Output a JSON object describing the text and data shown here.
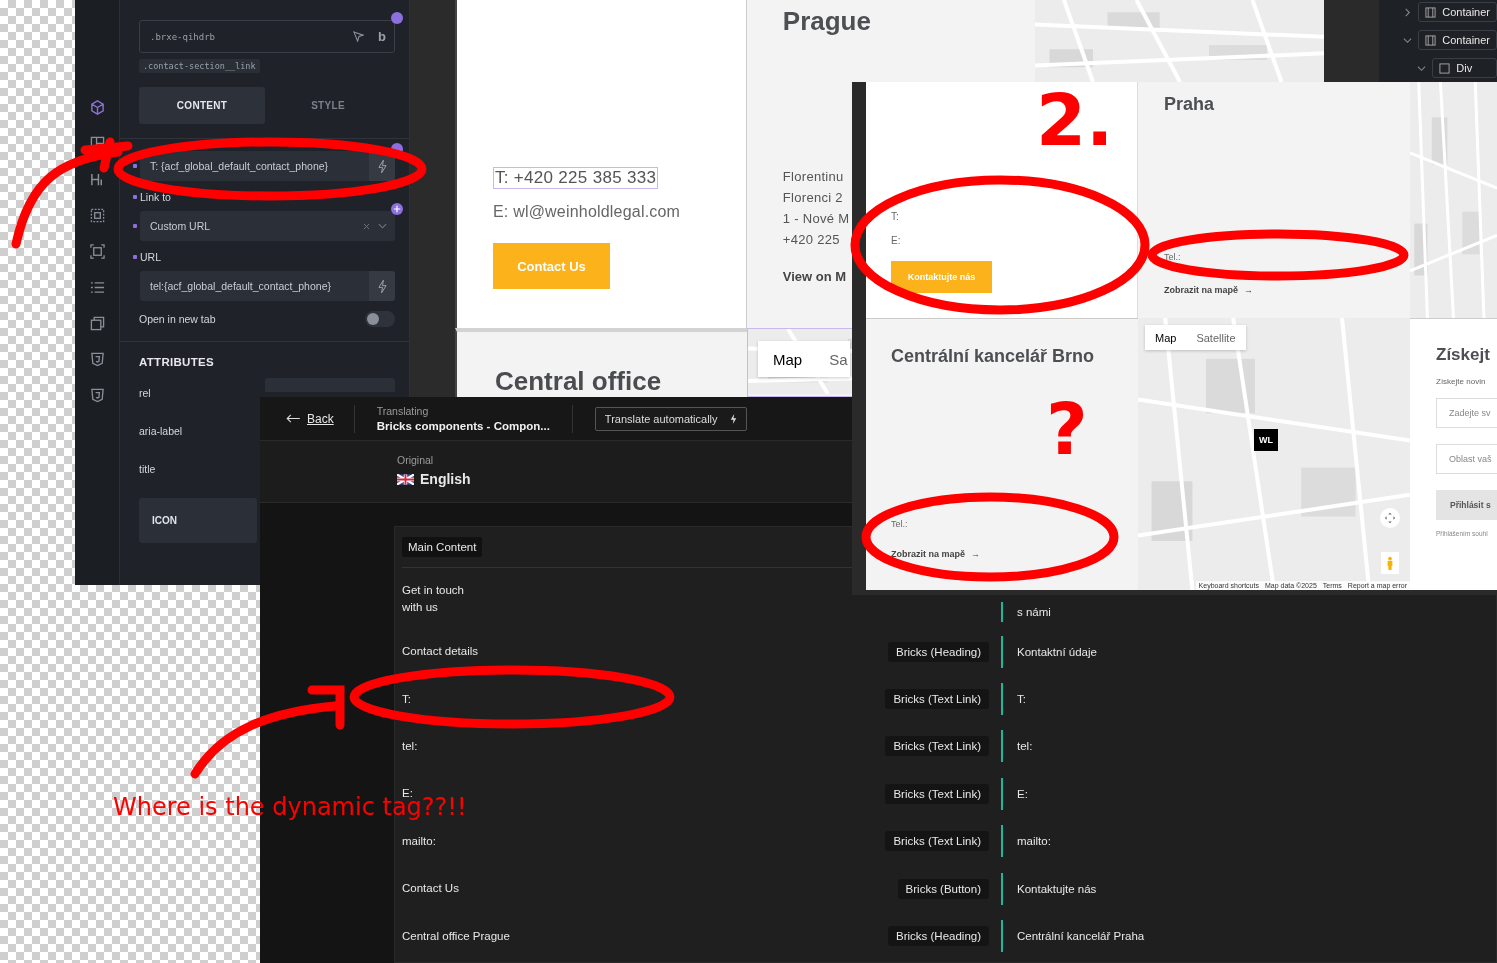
{
  "editor_panel": {
    "class_field": {
      "value": ".brxe-qihdrb",
      "badge": "b"
    },
    "class_tag": ".contact-section__link",
    "tabs": [
      {
        "label": "CONTENT",
        "selected": true
      },
      {
        "label": "STYLE",
        "selected": false
      }
    ],
    "text_field": {
      "value": "T: {acf_global_default_contact_phone}"
    },
    "link_to": {
      "label": "Link to",
      "value": "Custom URL"
    },
    "url": {
      "label": "URL",
      "value": "tel:{acf_global_default_contact_phone}"
    },
    "open_new_tab": {
      "label": "Open in new tab",
      "on": false
    },
    "attributes": {
      "title": "ATTRIBUTES",
      "rows": [
        "rel",
        "aria-label",
        "title"
      ]
    },
    "icon_section": "ICON"
  },
  "website_en": {
    "contact": {
      "phone": "T: +420 225 385 333",
      "email": "E: wl@weinholdlegal.com",
      "button": "Contact Us"
    },
    "prague": {
      "title": "Prague",
      "lines": [
        "Florentinu",
        "Florenci 2",
        "1 - Nové M",
        "+420 225"
      ],
      "map_link": "View on M"
    },
    "central_office": {
      "title": "Central office"
    },
    "map_tabs": [
      {
        "label": "Map",
        "selected": true
      },
      {
        "label": "Sa",
        "selected": false
      }
    ],
    "structure": [
      {
        "label": "Container",
        "expanded": false
      },
      {
        "label": "Container",
        "expanded": true,
        "children": [
          {
            "label": "Div",
            "expanded": true
          }
        ]
      }
    ]
  },
  "website_cz": {
    "contact": {
      "phone_label": "T:",
      "email_label": "E:",
      "button": "Kontaktujte nás"
    },
    "praha": {
      "title": "Praha",
      "phone_label": "Tel.:",
      "map_link": "Zobrazit na mapě",
      "arrow": "→"
    },
    "brno": {
      "title": "Centrální kancelář Brno",
      "phone_label": "Tel.:",
      "map_link": "Zobrazit na mapě",
      "arrow": "→"
    },
    "map": {
      "tabs": [
        {
          "label": "Map",
          "selected": true
        },
        {
          "label": "Satellite",
          "selected": false
        }
      ],
      "marker": "WL",
      "footer": [
        "Keyboard shortcuts",
        "Map data ©2025",
        "Terms",
        "Report a map error"
      ]
    },
    "newsletter": {
      "title": "Získejt",
      "text": "Získejte novin",
      "fields": [
        {
          "placeholder": "Zadejte sv"
        },
        {
          "placeholder": "Oblast vaš"
        }
      ],
      "button": "Přihlásit s",
      "note": "Přihlášením souhl"
    }
  },
  "translation": {
    "back": "Back",
    "translating_label": "Translating",
    "translating_title": "Bricks components - Compon...",
    "auto_button": "Translate automatically",
    "original_label": "Original",
    "language": "English",
    "section": "Main Content",
    "rows": [
      {
        "source": "Get in touch\nwith us",
        "target": "s námi"
      },
      {
        "source": "Contact details",
        "type": "Bricks (Heading)",
        "target": "Kontaktní údaje"
      },
      {
        "source": "T:",
        "type": "Bricks (Text Link)",
        "target": "T:"
      },
      {
        "source": "tel:",
        "type": "Bricks (Text Link)",
        "target": "tel:"
      },
      {
        "source": "E:",
        "type": "Bricks (Text Link)",
        "target": "E:"
      },
      {
        "source": "mailto:",
        "type": "Bricks (Text Link)",
        "target": "mailto:"
      },
      {
        "source": "Contact Us",
        "type": "Bricks (Button)",
        "target": "Kontaktujte nás"
      },
      {
        "source": "Central office Prague",
        "type": "Bricks (Heading)",
        "target": "Centrální kancelář Praha"
      }
    ]
  },
  "annotations": {
    "note": "Where is the dynamic tag??!!",
    "marks": [
      "2.",
      "?"
    ]
  }
}
